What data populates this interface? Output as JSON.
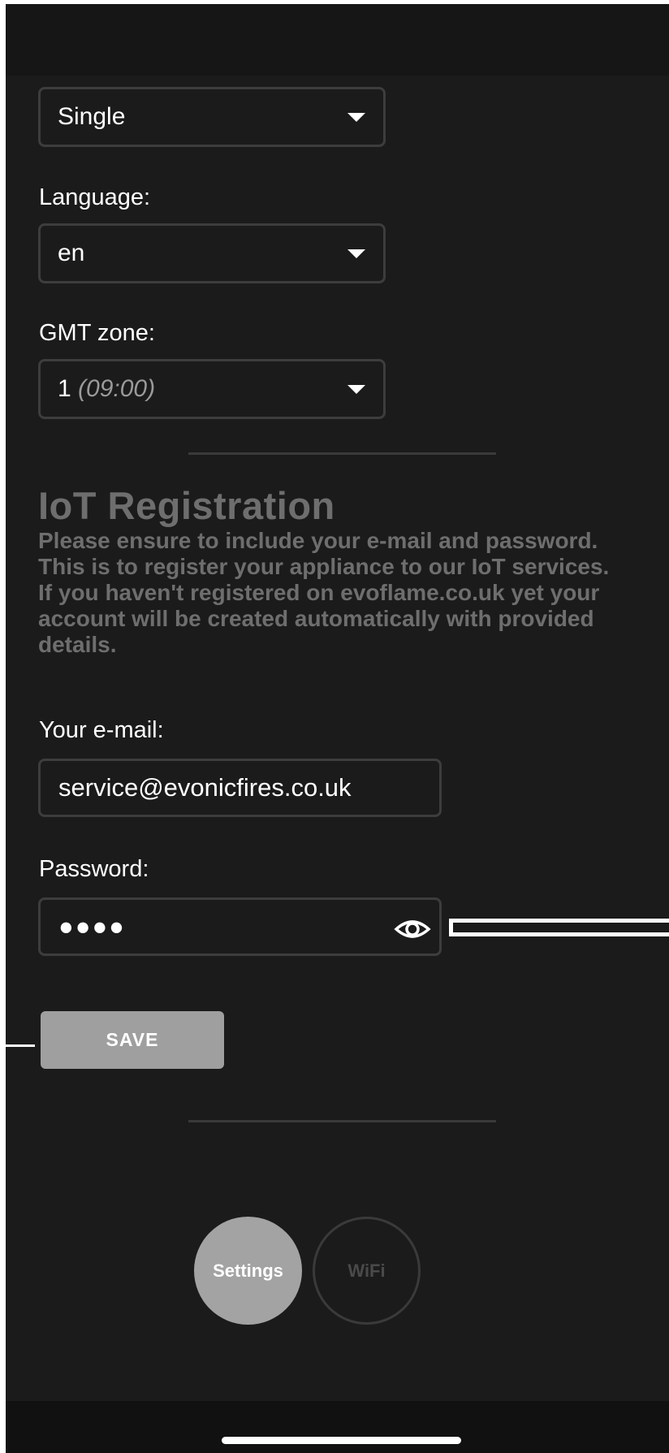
{
  "settings": {
    "mode_select": {
      "value": "Single"
    },
    "language": {
      "label": "Language:",
      "value": "en"
    },
    "gmt_zone": {
      "label": "GMT zone:",
      "value": "1",
      "hint": "(09:00)"
    }
  },
  "iot": {
    "title": "IoT Registration",
    "description_lines": [
      "Please ensure to include your e-mail and password. This is to register your appliance to our IoT services.",
      "If you haven't registered on evoflame.co.uk yet your account will be created automatically with provided details."
    ],
    "email": {
      "label": "Your e-mail:",
      "value": "service@evonicfires.co.uk"
    },
    "password": {
      "label": "Password:",
      "value": "●●●●"
    },
    "save_label": "SAVE"
  },
  "nav": {
    "settings_label": "Settings",
    "wifi_label": "WiFi"
  },
  "icons": {
    "dropdown": "chevron-down-icon",
    "password_visibility": "eye-icon"
  },
  "colors": {
    "background": "#1b1b1b",
    "muted_text": "#6e6e6e",
    "button": "#9f9f9f",
    "border": "#3d3d3d"
  }
}
